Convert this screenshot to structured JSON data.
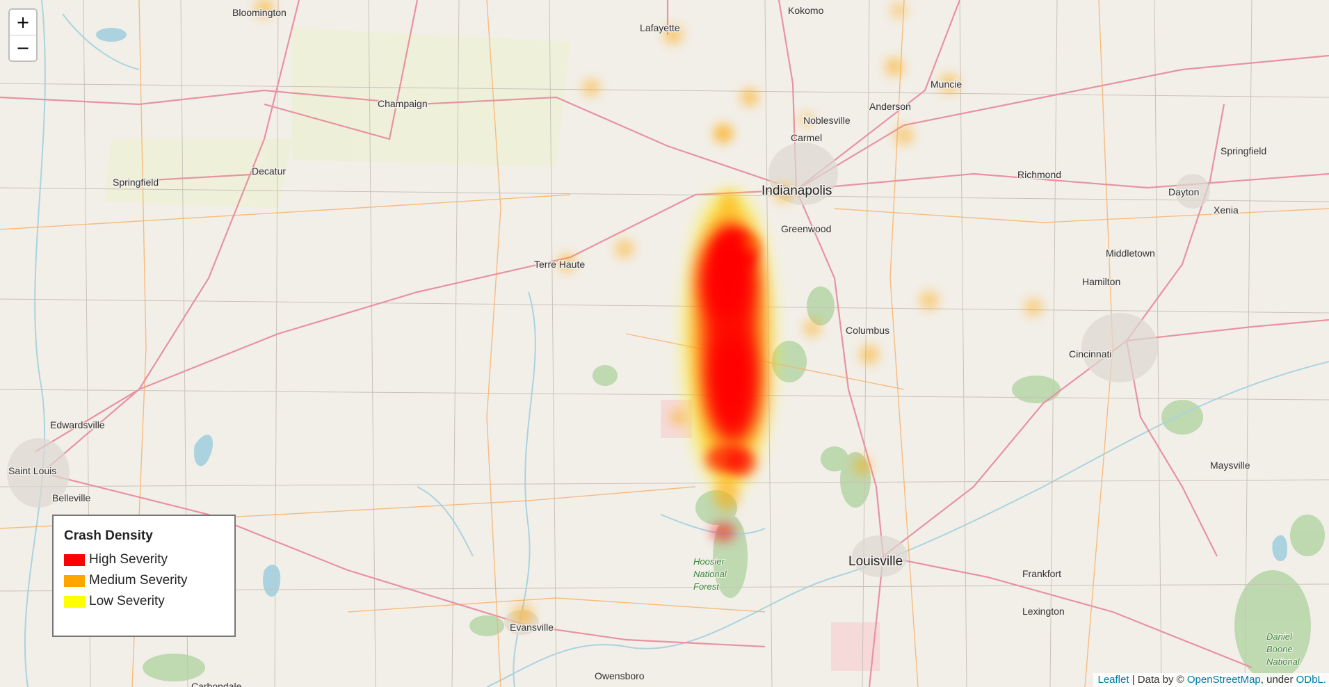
{
  "map": {
    "cities": [
      {
        "name": "Bloomington",
        "cls": "city-sm"
      },
      {
        "name": "Kokomo",
        "cls": "city-sm"
      },
      {
        "name": "Lafayette",
        "cls": "city-sm"
      },
      {
        "name": "Muncie",
        "cls": "city-sm"
      },
      {
        "name": "Champaign",
        "cls": "city-sm"
      },
      {
        "name": "Noblesville",
        "cls": "city-sm"
      },
      {
        "name": "Anderson",
        "cls": "city-sm"
      },
      {
        "name": "Carmel",
        "cls": "city-sm"
      },
      {
        "name": "Springfield",
        "cls": "city-sm"
      },
      {
        "name": "Decatur",
        "cls": "city-sm"
      },
      {
        "name": "Indianapolis",
        "cls": "city-big"
      },
      {
        "name": "Richmond",
        "cls": "city-sm"
      },
      {
        "name": "Dayton",
        "cls": "city-sm"
      },
      {
        "name": "Springfield",
        "cls": "city-sm"
      },
      {
        "name": "Greenwood",
        "cls": "city-sm"
      },
      {
        "name": "Xenia",
        "cls": "city-sm"
      },
      {
        "name": "Middletown",
        "cls": "city-sm"
      },
      {
        "name": "Terre Haute",
        "cls": "city-sm"
      },
      {
        "name": "Hamilton",
        "cls": "city-sm"
      },
      {
        "name": "Columbus",
        "cls": "city-sm"
      },
      {
        "name": "Cincinnati",
        "cls": "city-sm"
      },
      {
        "name": "Edwardsville",
        "cls": "city-sm"
      },
      {
        "name": "Saint Louis",
        "cls": "city-sm"
      },
      {
        "name": "Belleville",
        "cls": "city-sm"
      },
      {
        "name": "Maysville",
        "cls": "city-sm"
      },
      {
        "name": "Louisville",
        "cls": "city-big"
      },
      {
        "name": "Frankfort",
        "cls": "city-sm"
      },
      {
        "name": "Lexington",
        "cls": "city-sm"
      },
      {
        "name": "Evansville",
        "cls": "city-sm"
      },
      {
        "name": "Owensboro",
        "cls": "city-sm"
      },
      {
        "name": "Carbondale",
        "cls": "city-sm"
      }
    ],
    "forests": [
      {
        "lines": [
          "Hoosier",
          "National",
          "Forest"
        ]
      },
      {
        "lines": [
          "Daniel",
          "Boone",
          "National"
        ]
      }
    ]
  },
  "zoom": {
    "in_label": "+",
    "out_label": "−"
  },
  "legend": {
    "title": "Crash Density",
    "items": [
      {
        "label": "High Severity",
        "color": "#ff0000"
      },
      {
        "label": "Medium Severity",
        "color": "#ffa500"
      },
      {
        "label": "Low Severity",
        "color": "#ffff00"
      }
    ]
  },
  "attribution": {
    "leaflet": "Leaflet",
    "separator": " | Data by © ",
    "osm": "OpenStreetMap",
    "under": ", under ",
    "odbl": "ODbL."
  },
  "colors": {
    "land": "#f2efe9",
    "interstate": "#e892a2",
    "highway": "#f9b26a",
    "water": "#aad3df",
    "forest": "#add19e"
  }
}
